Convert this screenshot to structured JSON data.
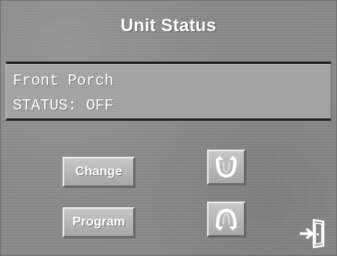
{
  "window": {
    "title": "Unit Status"
  },
  "status_panel": {
    "line_1": "Front Porch",
    "line_2": "STATUS: OFF"
  },
  "buttons": {
    "change_label": "Change",
    "program_label": "Program"
  },
  "icons": {
    "up_arrow": "up-curved-arrow-icon",
    "down_arrow": "down-curved-arrow-icon",
    "exit": "exit-door-icon"
  },
  "colors": {
    "text": "#ffffff",
    "background": "#8d8d8d",
    "button_face": "#b6b6b6",
    "divider": "#1f1f1f"
  }
}
